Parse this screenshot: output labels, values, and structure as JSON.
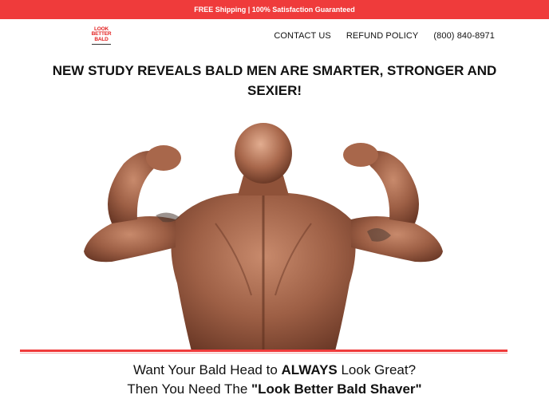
{
  "promo": {
    "text": "FREE Shipping | 100% Satisfaction Guaranteed"
  },
  "logo": {
    "line1": "LOOK",
    "line2": "BETTER",
    "line3": "BALD"
  },
  "nav": {
    "contact": "CONTACT US",
    "refund": "REFUND POLICY",
    "phone": "(800) 840-8971"
  },
  "headline": "NEW STUDY REVEALS BALD MEN ARE SMARTER, STRONGER AND SEXIER!",
  "hero": {
    "icon": "muscular-bald-man-back-image"
  },
  "tagline": {
    "line1_pre": "Want Your Bald Head to ",
    "line1_bold": "ALWAYS",
    "line1_post": " Look Great?",
    "line2_pre": "Then You Need The ",
    "line2_bold": "\"Look Better Bald Shaver\""
  },
  "colors": {
    "accent": "#ef3b3b",
    "logo_red": "#e32222"
  }
}
